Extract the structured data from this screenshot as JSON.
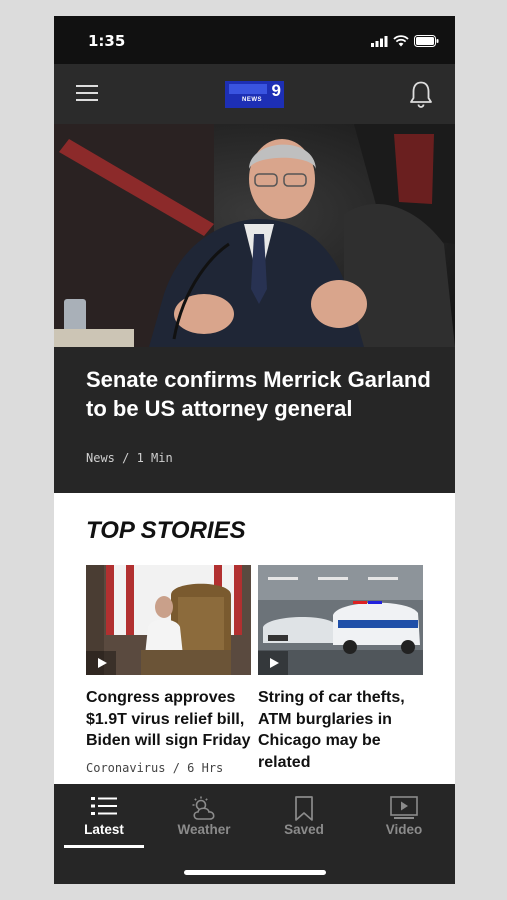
{
  "status_bar": {
    "time": "1:35"
  },
  "header": {
    "logo": {
      "number": "9",
      "sub": "NEWS",
      "brand": "WGN 9 NEWS"
    },
    "menu_icon": "hamburger-icon",
    "notifications_icon": "bell-icon"
  },
  "hero": {
    "title": "Senate confirms Merrick Garland to be US attorney general",
    "meta": "News / 1 Min"
  },
  "top_stories": {
    "heading": "TOP STORIES",
    "items": [
      {
        "title": "Congress approves $1.9T virus relief bill, Biden will sign Friday",
        "meta": "Coronavirus / 6 Hrs",
        "has_video": true
      },
      {
        "title": "String of car thefts, ATM burglaries in Chicago may be related",
        "meta": "",
        "has_video": true
      }
    ]
  },
  "tab_bar": {
    "tabs": [
      {
        "label": "Latest",
        "icon": "list-icon",
        "active": true
      },
      {
        "label": "Weather",
        "icon": "weather-icon",
        "active": false
      },
      {
        "label": "Saved",
        "icon": "bookmark-icon",
        "active": false
      },
      {
        "label": "Video",
        "icon": "video-play-icon",
        "active": false
      }
    ]
  },
  "colors": {
    "brand_blue": "#1d2fb5",
    "background_dark": "#262626",
    "accent_white": "#ffffff"
  }
}
